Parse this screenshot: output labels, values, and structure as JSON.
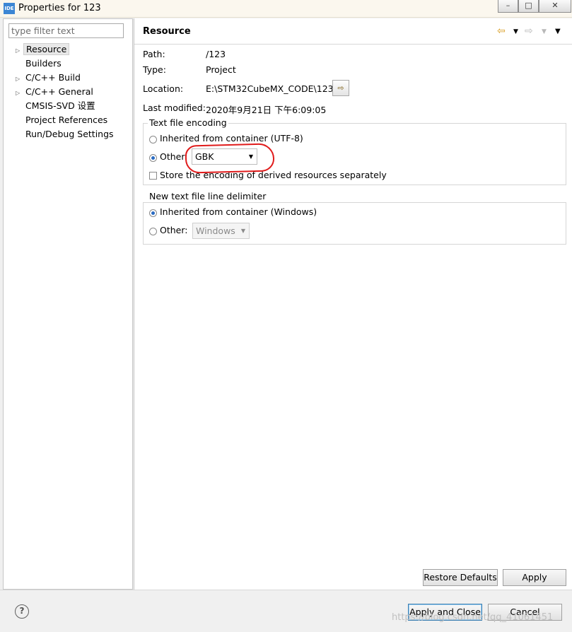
{
  "window": {
    "icon_text": "IDE",
    "title": "Properties for 123",
    "controls": {
      "minimize": "–",
      "maximize": "□",
      "close": "✕"
    }
  },
  "sidebar": {
    "filter_placeholder": "type filter text",
    "items": [
      {
        "label": "Resource",
        "expandable": true,
        "selected": true
      },
      {
        "label": "Builders",
        "expandable": false
      },
      {
        "label": "C/C++ Build",
        "expandable": true
      },
      {
        "label": "C/C++ General",
        "expandable": true
      },
      {
        "label": "CMSIS-SVD 设置",
        "expandable": false
      },
      {
        "label": "Project References",
        "expandable": false
      },
      {
        "label": "Run/Debug Settings",
        "expandable": false
      }
    ]
  },
  "page": {
    "title": "Resource",
    "nav": {
      "back_icon": "back-arrow",
      "forward_icon": "forward-arrow",
      "menu_icon": "view-menu"
    },
    "info": {
      "path_label": "Path:",
      "path": "/123",
      "type_label": "Type:",
      "type": "Project",
      "location_label": "Location:",
      "location": "E:\\STM32CubeMX_CODE\\123",
      "modified_label": "Last modified:",
      "modified": "2020年9月21日 下午6:09:05"
    },
    "encoding": {
      "group_title": "Text file encoding",
      "inherited_label": "Inherited from container (UTF-8)",
      "inherited_selected": false,
      "other_label": "Other:",
      "other_selected": true,
      "other_value": "GBK",
      "store_derived_label": "Store the encoding of derived resources separately",
      "store_derived_checked": false
    },
    "delimiter": {
      "group_title": "New text file line delimiter",
      "inherited_label": "Inherited from container (Windows)",
      "inherited_selected": true,
      "other_label": "Other:",
      "other_value": "Windows"
    },
    "restore_defaults_label": "Restore Defaults",
    "apply_label": "Apply"
  },
  "footer": {
    "apply_close_label": "Apply and Close",
    "cancel_label": "Cancel"
  },
  "watermark": "https://blog.csdn.net/qq_41061451",
  "colors": {
    "annotation": "#e01b1b",
    "selection_radio": "#2a6bc2"
  }
}
